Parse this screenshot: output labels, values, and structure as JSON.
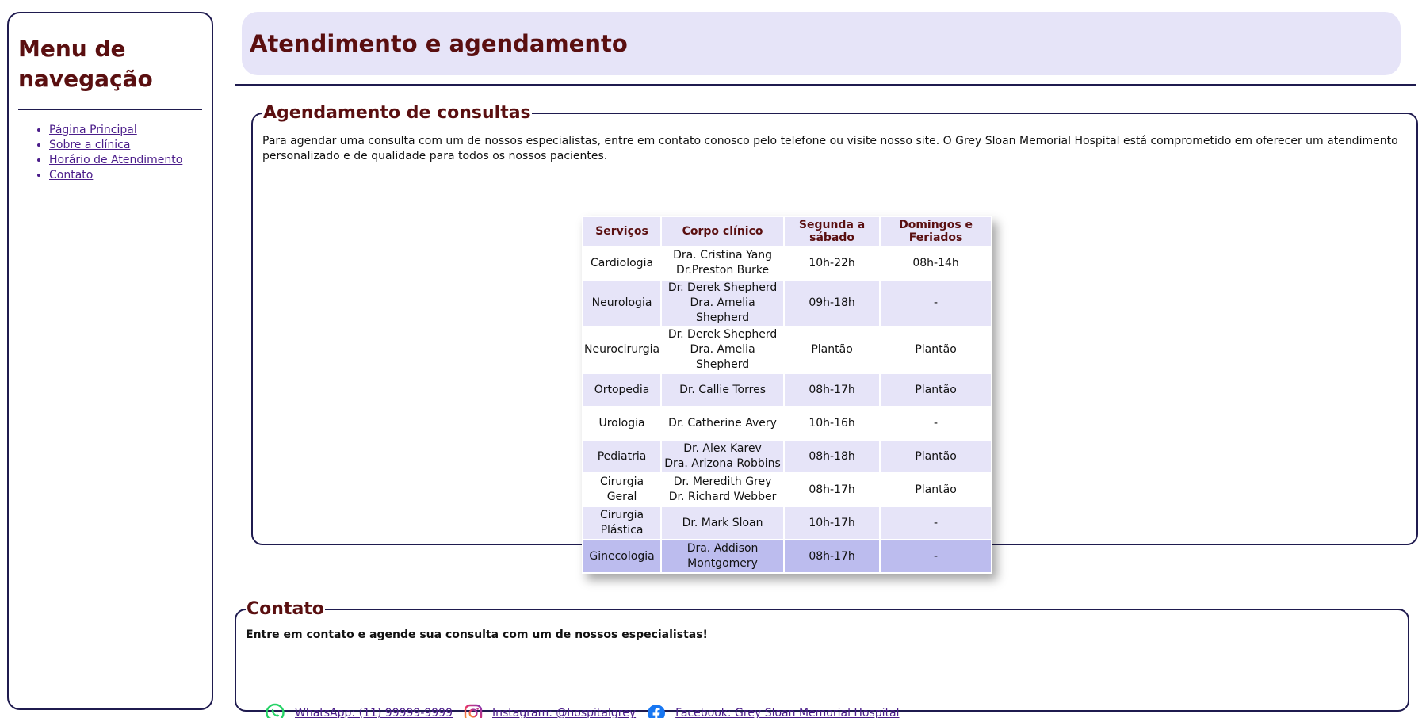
{
  "sidebar": {
    "title": "Menu de navegação",
    "items": [
      {
        "label": "Página Principal"
      },
      {
        "label": "Sobre a clínica"
      },
      {
        "label": "Horário de Atendimento"
      },
      {
        "label": "Contato"
      }
    ]
  },
  "header": {
    "title": "Atendimento e agendamento"
  },
  "schedule": {
    "legend": "Agendamento de consultas",
    "paragraph": "Para agendar uma consulta com um de nossos especialistas, entre em contato conosco pelo telefone ou visite nosso site. O Grey Sloan Memorial Hospital está comprometido em oferecer um atendimento personalizado e de qualidade para todos os nossos pacientes.",
    "table": {
      "headers": [
        "Serviços",
        "Corpo clínico",
        "Segunda a sábado",
        "Domingos e Feriados"
      ],
      "rows": [
        {
          "service": "Cardiologia",
          "doctors": [
            "Dra. Cristina Yang",
            "Dr.Preston Burke"
          ],
          "weekdays": "10h-22h",
          "weekends": "08h-14h"
        },
        {
          "service": "Neurologia",
          "doctors": [
            "Dr. Derek Shepherd",
            "Dra. Amelia Shepherd"
          ],
          "weekdays": "09h-18h",
          "weekends": "-"
        },
        {
          "service": "Neurocirurgia",
          "doctors": [
            "Dr. Derek Shepherd",
            "Dra. Amelia Shepherd"
          ],
          "weekdays": "Plantão",
          "weekends": "Plantão"
        },
        {
          "service": "Ortopedia",
          "doctors": [
            "Dr. Callie Torres"
          ],
          "weekdays": "08h-17h",
          "weekends": "Plantão"
        },
        {
          "service": "Urologia",
          "doctors": [
            "Dr. Catherine Avery"
          ],
          "weekdays": "10h-16h",
          "weekends": "-"
        },
        {
          "service": "Pediatria",
          "doctors": [
            "Dr. Alex Karev",
            "Dra. Arizona Robbins"
          ],
          "weekdays": "08h-18h",
          "weekends": "Plantão"
        },
        {
          "service": "Cirurgia Geral",
          "doctors": [
            "Dr. Meredith Grey",
            "Dr. Richard Webber"
          ],
          "weekdays": "08h-17h",
          "weekends": "Plantão"
        },
        {
          "service": "Cirurgia Plástica",
          "doctors": [
            "Dr. Mark Sloan"
          ],
          "weekdays": "10h-17h",
          "weekends": "-"
        },
        {
          "service": "Ginecologia",
          "doctors": [
            "Dra. Addison Montgomery"
          ],
          "weekdays": "08h-17h",
          "weekends": "-"
        }
      ]
    }
  },
  "contact": {
    "legend": "Contato",
    "lead": "Entre em contato e agende sua consulta com um de nossos especialistas!",
    "whatsapp": "WhatsApp: (11) 99999-9999",
    "instagram": "Instagram: @hospitalgrey",
    "facebook": "Facebook: Grey Sloan Memorial Hospital"
  },
  "colors": {
    "heading": "#5a0f10",
    "border": "#1f1b4f",
    "header_bg": "#e6e4f8",
    "row_alt_bg": "#e6e4f8",
    "row_last_bg": "#bcbcee",
    "link": "#4b1d8a",
    "whatsapp": "#25d366",
    "facebook": "#1877f2"
  },
  "icons": [
    "whatsapp-icon",
    "instagram-icon",
    "facebook-icon"
  ]
}
